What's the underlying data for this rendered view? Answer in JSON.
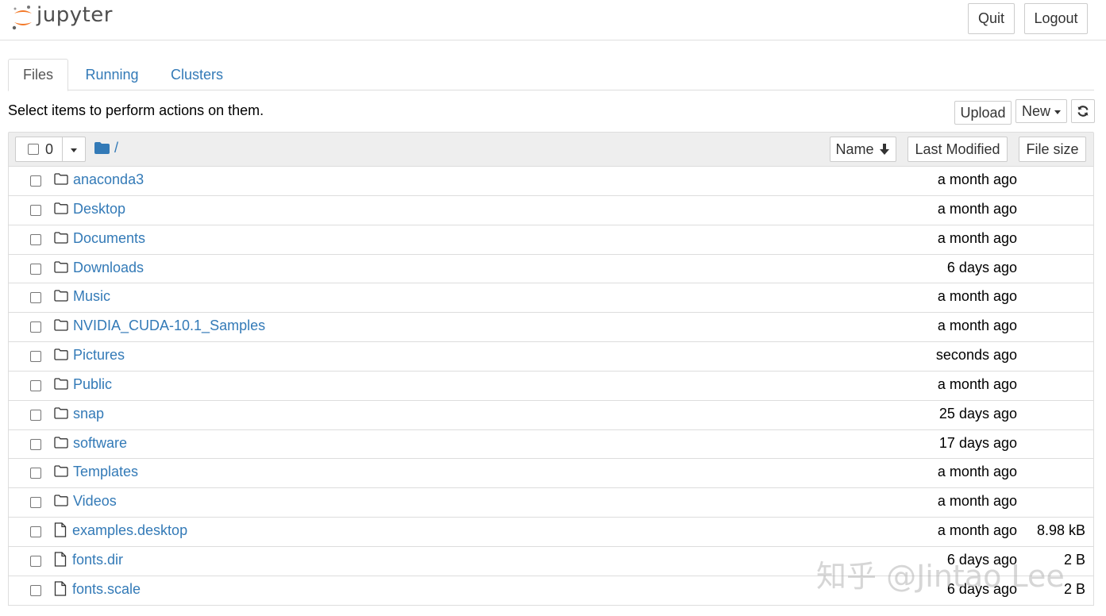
{
  "header": {
    "logo_text": "jupyter",
    "quit_label": "Quit",
    "logout_label": "Logout"
  },
  "tabs": [
    {
      "label": "Files",
      "active": true
    },
    {
      "label": "Running",
      "active": false
    },
    {
      "label": "Clusters",
      "active": false
    }
  ],
  "toolbar": {
    "hint": "Select items to perform actions on them.",
    "upload_label": "Upload",
    "new_label": "New",
    "refresh_icon": "refresh-icon"
  },
  "list_header": {
    "selected_count": "0",
    "path": "/",
    "sort_name_label": "Name",
    "sort_modified_label": "Last Modified",
    "sort_size_label": "File size"
  },
  "items": [
    {
      "type": "folder",
      "name": "anaconda3",
      "modified": "a month ago",
      "size": ""
    },
    {
      "type": "folder",
      "name": "Desktop",
      "modified": "a month ago",
      "size": ""
    },
    {
      "type": "folder",
      "name": "Documents",
      "modified": "a month ago",
      "size": ""
    },
    {
      "type": "folder",
      "name": "Downloads",
      "modified": "6 days ago",
      "size": ""
    },
    {
      "type": "folder",
      "name": "Music",
      "modified": "a month ago",
      "size": ""
    },
    {
      "type": "folder",
      "name": "NVIDIA_CUDA-10.1_Samples",
      "modified": "a month ago",
      "size": ""
    },
    {
      "type": "folder",
      "name": "Pictures",
      "modified": "seconds ago",
      "size": ""
    },
    {
      "type": "folder",
      "name": "Public",
      "modified": "a month ago",
      "size": ""
    },
    {
      "type": "folder",
      "name": "snap",
      "modified": "25 days ago",
      "size": ""
    },
    {
      "type": "folder",
      "name": "software",
      "modified": "17 days ago",
      "size": ""
    },
    {
      "type": "folder",
      "name": "Templates",
      "modified": "a month ago",
      "size": ""
    },
    {
      "type": "folder",
      "name": "Videos",
      "modified": "a month ago",
      "size": ""
    },
    {
      "type": "file",
      "name": "examples.desktop",
      "modified": "a month ago",
      "size": "8.98 kB"
    },
    {
      "type": "file",
      "name": "fonts.dir",
      "modified": "6 days ago",
      "size": "2 B"
    },
    {
      "type": "file",
      "name": "fonts.scale",
      "modified": "6 days ago",
      "size": "2 B"
    }
  ],
  "watermark": "知乎 @Jintao Lee",
  "colors": {
    "link": "#337ab7",
    "logo_orange": "#f37726",
    "header_bg": "#eeeeee"
  }
}
